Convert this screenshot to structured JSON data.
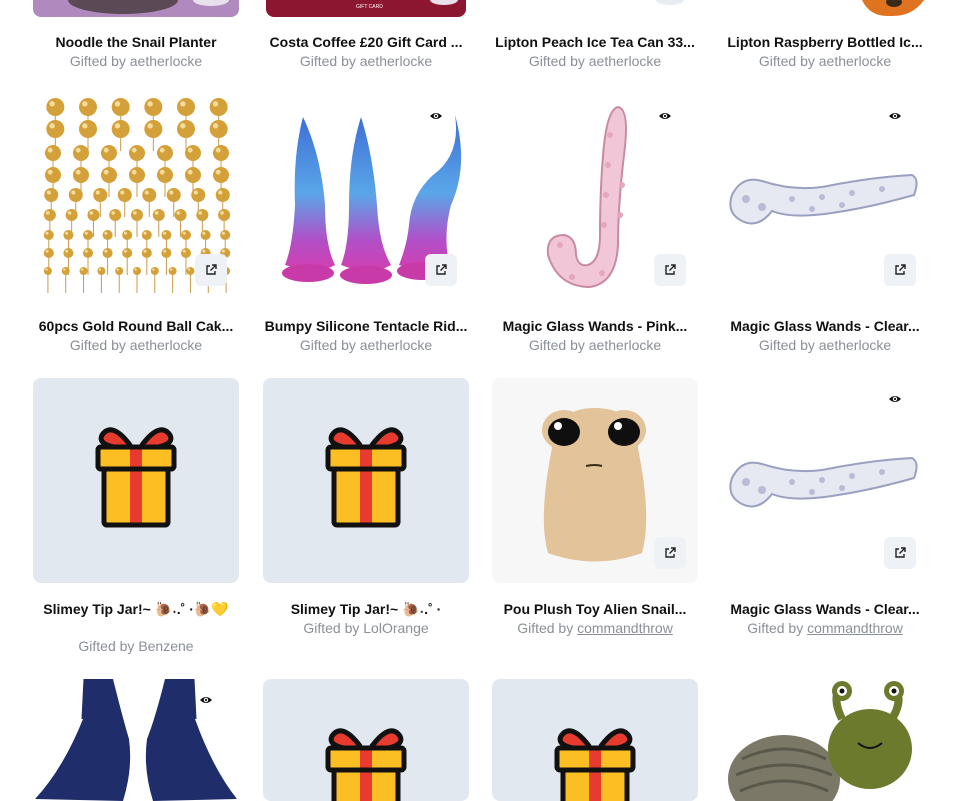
{
  "row1": [
    {
      "title": "Noodle the Snail Planter",
      "gifted_prefix": "Gifted by",
      "gifter": "aetherlocke",
      "bg": "#b08abe"
    },
    {
      "title": "Costa Coffee £20 Gift Card ...",
      "gifted_prefix": "Gifted by",
      "gifter": "aetherlocke",
      "bg": "#8c1530",
      "caption": "GIFT CARD"
    },
    {
      "title": "Lipton Peach Ice Tea Can 33...",
      "gifted_prefix": "Gifted by",
      "gifter": "aetherlocke",
      "bg": "#ffffff"
    },
    {
      "title": "Lipton Raspberry Bottled Ic...",
      "gifted_prefix": "Gifted by",
      "gifter": "aetherlocke",
      "bg": "#ffffff"
    }
  ],
  "row2": [
    {
      "title": "60pcs Gold Round Ball Cak...",
      "gifted_prefix": "Gifted by",
      "gifter": "aetherlocke",
      "icon": "external-link-icon"
    },
    {
      "title": "Bumpy Silicone Tentacle Rid...",
      "gifted_prefix": "Gifted by",
      "gifter": "aetherlocke",
      "icon": "external-link-icon"
    },
    {
      "title": "Magic Glass Wands - Pink...",
      "gifted_prefix": "Gifted by",
      "gifter": "aetherlocke",
      "icon": "external-link-icon"
    },
    {
      "title": "Magic Glass Wands - Clear...",
      "gifted_prefix": "Gifted by",
      "gifter": "aetherlocke",
      "icon": "external-link-icon"
    }
  ],
  "row3": [
    {
      "title": "Slimey Tip Jar!~ 🐌˖.˚ ·🐌💛",
      "gifted_prefix": "Gifted by",
      "gifter": "Benzene"
    },
    {
      "title": "Slimey Tip Jar!~ 🐌˖.˚ ·",
      "gifted_prefix": "Gifted by",
      "gifter": "LolOrange"
    },
    {
      "title": "Pou Plush Toy Alien Snail...",
      "gifted_prefix": "Gifted by",
      "gifter": "commandthrow"
    },
    {
      "title": "Magic Glass Wands - Clear...",
      "gifted_prefix": "Gifted by",
      "gifter": "commandthrow"
    }
  ],
  "colors": {
    "placeholder": "#e2e8f0",
    "title": "#111111",
    "gifter": "#8a8f98",
    "gift_box": "#fbbf24",
    "gift_ribbon": "#e63b2e",
    "gold": "#d4a03a",
    "glass": "#c9cbe0",
    "pink_glass": "#f1c6d6",
    "plush": "#e2c39a",
    "bikini": "#1f2d6b",
    "snail_green": "#6b7a2c"
  }
}
